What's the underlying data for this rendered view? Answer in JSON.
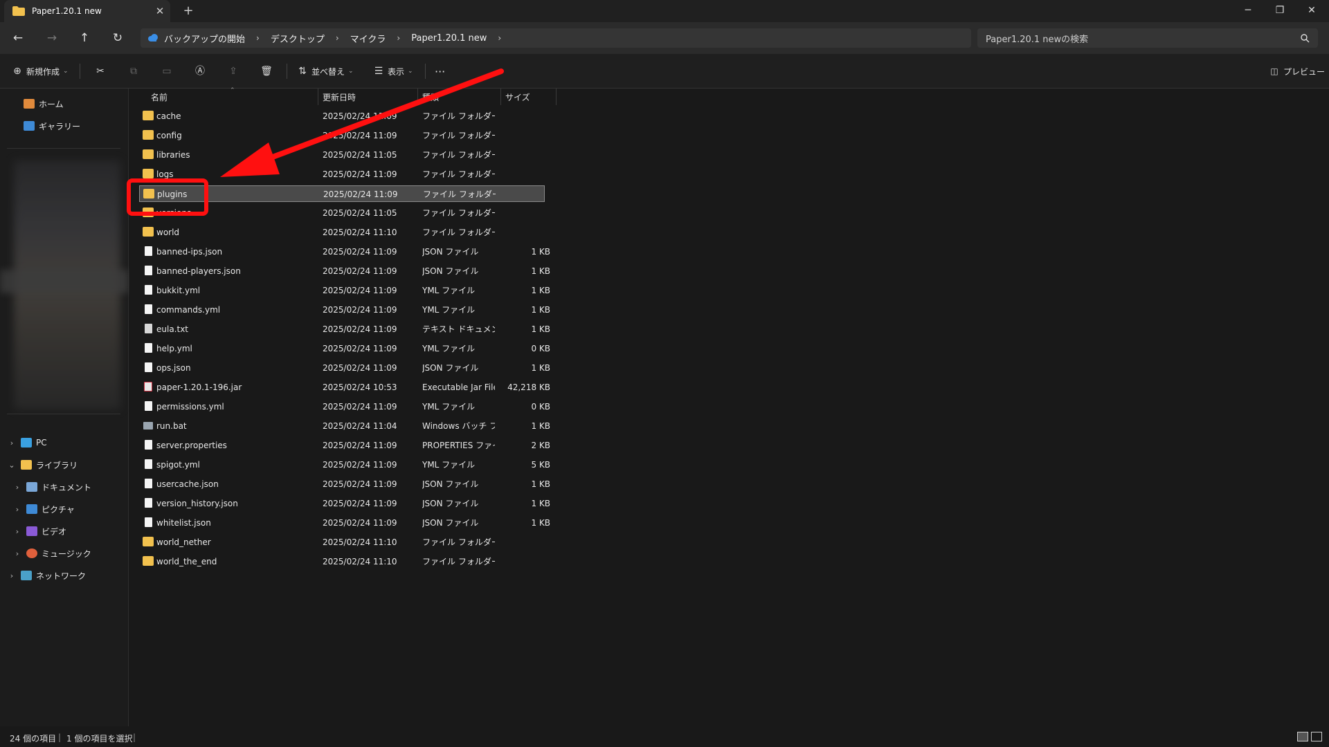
{
  "window": {
    "tab_title": "Paper1.20.1 new",
    "tab_close": "✕",
    "new_tab": "+",
    "minimize": "─",
    "restore": "❐",
    "close": "✕"
  },
  "nav": {
    "back": "←",
    "forward": "→",
    "up": "↑",
    "refresh": "↻",
    "breadcrumbs": [
      "バックアップの開始",
      "デスクトップ",
      "マイクラ",
      "Paper1.20.1 new"
    ],
    "search_placeholder": "Paper1.20.1 newの検索"
  },
  "toolbar": {
    "new_label": "新規作成",
    "sort_label": "並べ替え",
    "view_label": "表示",
    "more": "···",
    "preview_label": "プレビュー"
  },
  "sidebar": {
    "home": "ホーム",
    "gallery": "ギャラリー",
    "pc": "PC",
    "library": "ライブラリ",
    "documents": "ドキュメント",
    "pictures": "ピクチャ",
    "videos": "ビデオ",
    "music": "ミュージック",
    "network": "ネットワーク"
  },
  "columns": {
    "name": "名前",
    "date": "更新日時",
    "type": "種類",
    "size": "サイズ"
  },
  "files": [
    {
      "name": "cache",
      "date": "2025/02/24 11:09",
      "type": "ファイル フォルダー",
      "size": "",
      "icon": "folder"
    },
    {
      "name": "config",
      "date": "2025/02/24 11:09",
      "type": "ファイル フォルダー",
      "size": "",
      "icon": "folder"
    },
    {
      "name": "libraries",
      "date": "2025/02/24 11:05",
      "type": "ファイル フォルダー",
      "size": "",
      "icon": "folder"
    },
    {
      "name": "logs",
      "date": "2025/02/24 11:09",
      "type": "ファイル フォルダー",
      "size": "",
      "icon": "folder"
    },
    {
      "name": "plugins",
      "date": "2025/02/24 11:09",
      "type": "ファイル フォルダー",
      "size": "",
      "icon": "folder",
      "selected": true
    },
    {
      "name": "versions",
      "date": "2025/02/24 11:05",
      "type": "ファイル フォルダー",
      "size": "",
      "icon": "folder"
    },
    {
      "name": "world",
      "date": "2025/02/24 11:10",
      "type": "ファイル フォルダー",
      "size": "",
      "icon": "folder"
    },
    {
      "name": "banned-ips.json",
      "date": "2025/02/24 11:09",
      "type": "JSON ファイル",
      "size": "1 KB",
      "icon": "file"
    },
    {
      "name": "banned-players.json",
      "date": "2025/02/24 11:09",
      "type": "JSON ファイル",
      "size": "1 KB",
      "icon": "file"
    },
    {
      "name": "bukkit.yml",
      "date": "2025/02/24 11:09",
      "type": "YML ファイル",
      "size": "1 KB",
      "icon": "file"
    },
    {
      "name": "commands.yml",
      "date": "2025/02/24 11:09",
      "type": "YML ファイル",
      "size": "1 KB",
      "icon": "file"
    },
    {
      "name": "eula.txt",
      "date": "2025/02/24 11:09",
      "type": "テキスト ドキュメント",
      "size": "1 KB",
      "icon": "txt"
    },
    {
      "name": "help.yml",
      "date": "2025/02/24 11:09",
      "type": "YML ファイル",
      "size": "0 KB",
      "icon": "file"
    },
    {
      "name": "ops.json",
      "date": "2025/02/24 11:09",
      "type": "JSON ファイル",
      "size": "1 KB",
      "icon": "file"
    },
    {
      "name": "paper-1.20.1-196.jar",
      "date": "2025/02/24 10:53",
      "type": "Executable Jar File",
      "size": "42,218 KB",
      "icon": "jar"
    },
    {
      "name": "permissions.yml",
      "date": "2025/02/24 11:09",
      "type": "YML ファイル",
      "size": "0 KB",
      "icon": "file"
    },
    {
      "name": "run.bat",
      "date": "2025/02/24 11:04",
      "type": "Windows バッチ ファ...",
      "size": "1 KB",
      "icon": "bat"
    },
    {
      "name": "server.properties",
      "date": "2025/02/24 11:09",
      "type": "PROPERTIES ファイル",
      "size": "2 KB",
      "icon": "file"
    },
    {
      "name": "spigot.yml",
      "date": "2025/02/24 11:09",
      "type": "YML ファイル",
      "size": "5 KB",
      "icon": "file"
    },
    {
      "name": "usercache.json",
      "date": "2025/02/24 11:09",
      "type": "JSON ファイル",
      "size": "1 KB",
      "icon": "file"
    },
    {
      "name": "version_history.json",
      "date": "2025/02/24 11:09",
      "type": "JSON ファイル",
      "size": "1 KB",
      "icon": "file"
    },
    {
      "name": "whitelist.json",
      "date": "2025/02/24 11:09",
      "type": "JSON ファイル",
      "size": "1 KB",
      "icon": "file"
    },
    {
      "name": "world_nether",
      "date": "2025/02/24 11:10",
      "type": "ファイル フォルダー",
      "size": "",
      "icon": "folder"
    },
    {
      "name": "world_the_end",
      "date": "2025/02/24 11:10",
      "type": "ファイル フォルダー",
      "size": "",
      "icon": "folder"
    }
  ],
  "status": {
    "count": "24 個の項目",
    "selected": "1 個の項目を選択"
  },
  "colors": {
    "annotation": "#ff1010",
    "folder": "#f2c14e",
    "selection": "#4a4a4a"
  }
}
